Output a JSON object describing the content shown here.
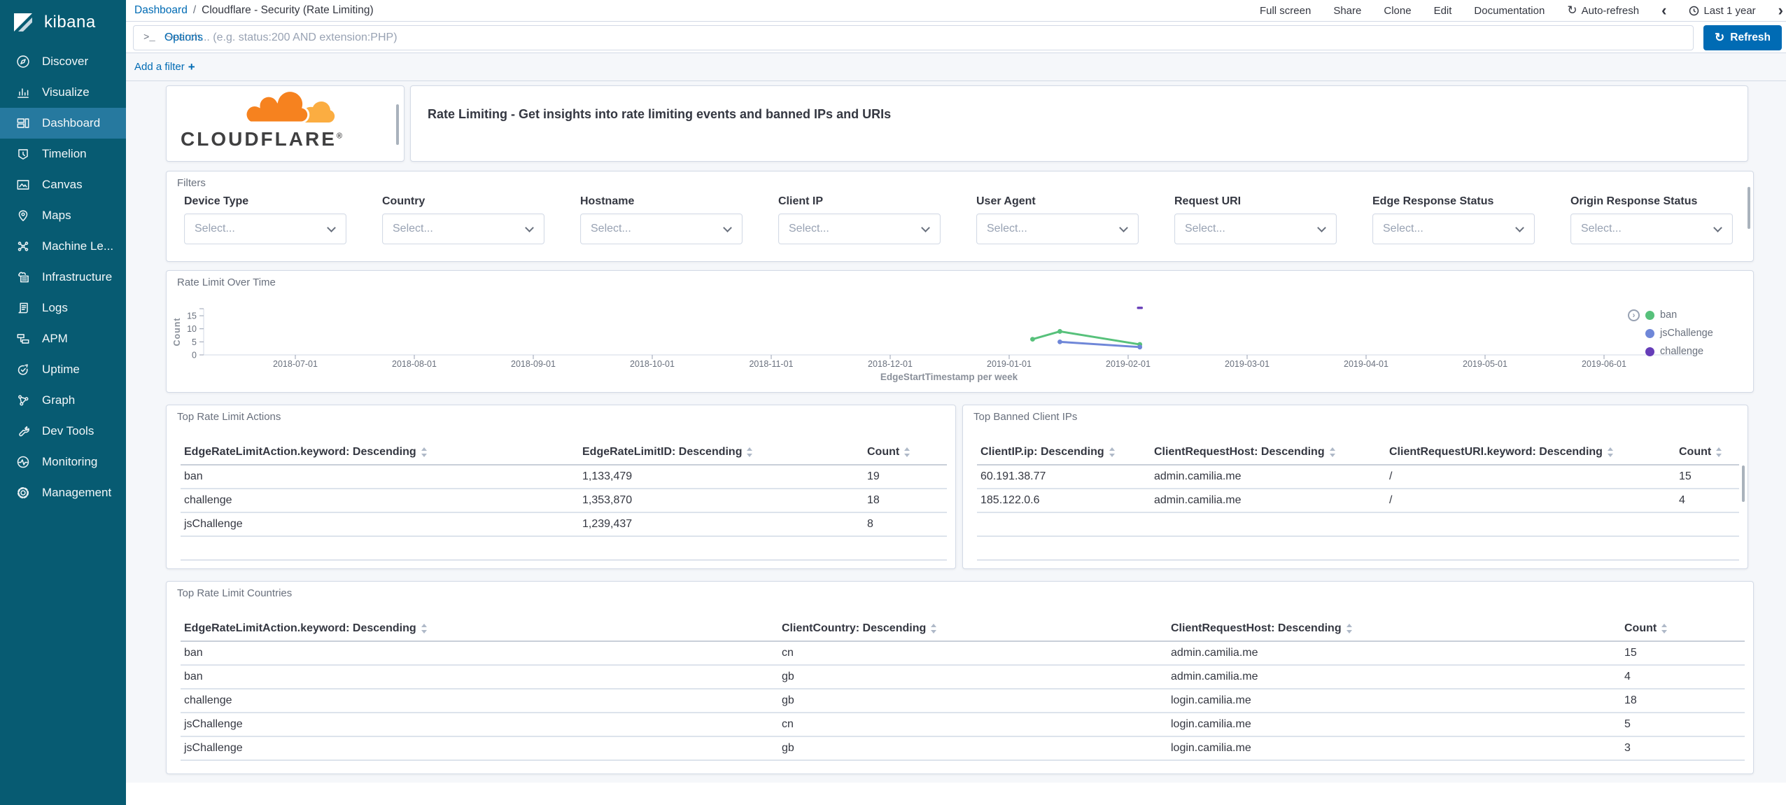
{
  "colors": {
    "accent_blue": "#006BB4",
    "sidebar_bg": "#075B72",
    "sidebar_selected": "#26799F",
    "cloudflare_orange": "#F6821F",
    "cloudflare_light_orange": "#FBAD41"
  },
  "sidebar": {
    "product": "kibana",
    "items": [
      {
        "label": "Discover",
        "icon": "discover-icon",
        "selected": false
      },
      {
        "label": "Visualize",
        "icon": "visualize-icon",
        "selected": false
      },
      {
        "label": "Dashboard",
        "icon": "dashboard-icon",
        "selected": true
      },
      {
        "label": "Timelion",
        "icon": "timelion-icon",
        "selected": false
      },
      {
        "label": "Canvas",
        "icon": "canvas-icon",
        "selected": false
      },
      {
        "label": "Maps",
        "icon": "maps-icon",
        "selected": false
      },
      {
        "label": "Machine Le...",
        "icon": "machine-learning-icon",
        "selected": false
      },
      {
        "label": "Infrastructure",
        "icon": "infrastructure-icon",
        "selected": false
      },
      {
        "label": "Logs",
        "icon": "logs-icon",
        "selected": false
      },
      {
        "label": "APM",
        "icon": "apm-icon",
        "selected": false
      },
      {
        "label": "Uptime",
        "icon": "uptime-icon",
        "selected": false
      },
      {
        "label": "Graph",
        "icon": "graph-icon",
        "selected": false
      },
      {
        "label": "Dev Tools",
        "icon": "dev-tools-icon",
        "selected": false
      },
      {
        "label": "Monitoring",
        "icon": "monitoring-icon",
        "selected": false
      },
      {
        "label": "Management",
        "icon": "management-icon",
        "selected": false
      }
    ]
  },
  "topnav": {
    "breadcrumb_link": "Dashboard",
    "breadcrumb_sep": "/",
    "breadcrumb_current": "Cloudflare - Security (Rate Limiting)",
    "menu": [
      "Full screen",
      "Share",
      "Clone",
      "Edit",
      "Documentation"
    ],
    "auto_refresh": "Auto-refresh",
    "time_prev": "‹",
    "time_range": "Last 1 year",
    "time_next": "›"
  },
  "querybar": {
    "prompt": ">_",
    "placeholder": "Search... (e.g. status:200 AND extension:PHP)",
    "options": "Options",
    "refresh": "Refresh",
    "refresh_icon": "↻"
  },
  "filter_row": {
    "add_filter": "Add a filter",
    "plus": "+"
  },
  "logo_panel": {
    "brand": "CLOUDFLARE",
    "registered": "®"
  },
  "description_panel": {
    "text": "Rate Limiting - Get insights into rate limiting events and banned IPs and URIs"
  },
  "filters_panel": {
    "title": "Filters",
    "select_placeholder": "Select...",
    "fields": [
      "Device Type",
      "Country",
      "Hostname",
      "Client IP",
      "User Agent",
      "Request URI",
      "Edge Response Status",
      "Origin Response Status"
    ]
  },
  "chart_data": {
    "type": "line",
    "title": "Rate Limit Over Time",
    "xlabel": "EdgeStartTimestamp per week",
    "ylabel": "Count",
    "ylim": [
      0,
      17.5
    ],
    "yticks": [
      0,
      5,
      10,
      15
    ],
    "x_ticks": [
      "2018-07-01",
      "2018-08-01",
      "2018-09-01",
      "2018-10-01",
      "2018-11-01",
      "2018-12-01",
      "2019-01-01",
      "2019-02-01",
      "2019-03-01",
      "2019-04-01",
      "2019-05-01",
      "2019-06-01"
    ],
    "grid": false,
    "legend_position": "right",
    "series": [
      {
        "name": "ban",
        "color": "#57C17B",
        "points": [
          [
            "2019-01-07",
            6
          ],
          [
            "2019-01-14",
            9
          ],
          [
            "2019-02-04",
            4
          ]
        ]
      },
      {
        "name": "jsChallenge",
        "color": "#6F87D8",
        "points": [
          [
            "2019-01-14",
            5
          ],
          [
            "2019-02-04",
            3
          ]
        ]
      },
      {
        "name": "challenge",
        "color": "#663DB8",
        "points": [
          [
            "2019-02-04",
            18
          ]
        ]
      }
    ]
  },
  "actions_table": {
    "title": "Top Rate Limit Actions",
    "columns": [
      "EdgeRateLimitAction.keyword: Descending",
      "EdgeRateLimitID: Descending",
      "Count"
    ],
    "rows": [
      [
        "ban",
        "1,133,479",
        "19"
      ],
      [
        "challenge",
        "1,353,870",
        "18"
      ],
      [
        "jsChallenge",
        "1,239,437",
        "8"
      ]
    ]
  },
  "banned_table": {
    "title": "Top Banned Client IPs",
    "columns": [
      "ClientIP.ip: Descending",
      "ClientRequestHost: Descending",
      "ClientRequestURI.keyword: Descending",
      "Count"
    ],
    "rows": [
      [
        "60.191.38.77",
        "admin.camilia.me",
        "/",
        "15"
      ],
      [
        "185.122.0.6",
        "admin.camilia.me",
        "/",
        "4"
      ]
    ]
  },
  "countries_table": {
    "title": "Top Rate Limit Countries",
    "columns": [
      "EdgeRateLimitAction.keyword: Descending",
      "ClientCountry: Descending",
      "ClientRequestHost: Descending",
      "Count"
    ],
    "rows": [
      [
        "ban",
        "cn",
        "admin.camilia.me",
        "15"
      ],
      [
        "ban",
        "gb",
        "admin.camilia.me",
        "4"
      ],
      [
        "challenge",
        "gb",
        "login.camilia.me",
        "18"
      ],
      [
        "jsChallenge",
        "cn",
        "login.camilia.me",
        "5"
      ],
      [
        "jsChallenge",
        "gb",
        "login.camilia.me",
        "3"
      ]
    ]
  }
}
